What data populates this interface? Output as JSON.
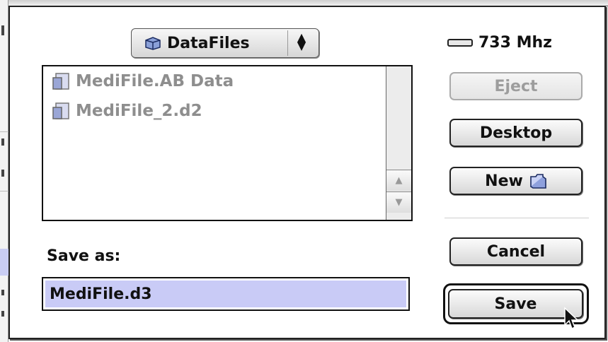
{
  "folder_popup": {
    "label": "DataFiles",
    "icon": "folder-icon"
  },
  "drive": {
    "label": "733 Mhz",
    "icon": "hard-disk-icon"
  },
  "file_list": {
    "items": [
      {
        "name": "MediFile.AB Data",
        "icon": "document-icon"
      },
      {
        "name": "MediFile_2.d2",
        "icon": "document-icon"
      }
    ]
  },
  "buttons": {
    "eject": "Eject",
    "desktop": "Desktop",
    "new": "New",
    "cancel": "Cancel",
    "save": "Save"
  },
  "save_as": {
    "label": "Save as:",
    "value": "MediFile.d3"
  },
  "colors": {
    "selection": "#c9cbf6",
    "disabled_text": "#9d9d9d",
    "file_text": "#8e8e8e"
  }
}
